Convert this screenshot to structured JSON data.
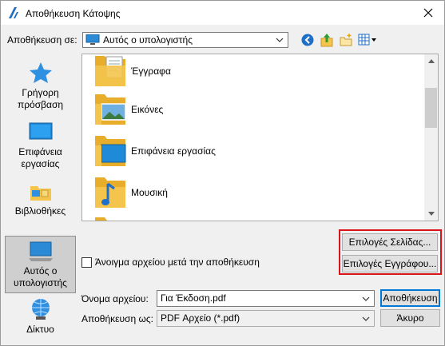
{
  "window": {
    "title": "Αποθήκευση Κάτοψης"
  },
  "toolbar": {
    "save_in_label": "Αποθήκευση σε:",
    "location_value": "Αυτός ο υπολογιστής",
    "icons": [
      "back-icon",
      "up-folder-icon",
      "new-folder-icon",
      "view-menu-icon"
    ]
  },
  "places": [
    {
      "label": "Γρήγορη πρόσβαση",
      "icon": "star-icon"
    },
    {
      "label": "Επιφάνεια εργασίας",
      "icon": "desktop-icon"
    },
    {
      "label": "Βιβλιοθήκες",
      "icon": "libraries-icon"
    },
    {
      "label": "Αυτός ο υπολογιστής",
      "icon": "computer-icon",
      "selected": true
    },
    {
      "label": "Δίκτυο",
      "icon": "network-icon"
    }
  ],
  "files": [
    {
      "name": "Έγγραφα",
      "icon": "documents-folder-icon"
    },
    {
      "name": "Εικόνες",
      "icon": "pictures-folder-icon"
    },
    {
      "name": "Επιφάνεια εργασίας",
      "icon": "desktop-folder-icon"
    },
    {
      "name": "Μουσική",
      "icon": "music-folder-icon"
    }
  ],
  "options": {
    "open_after_save_label": "Άνοιγμα αρχείου μετά την αποθήκευση",
    "open_after_save_checked": false,
    "page_options_button": "Επιλογές Σελίδας...",
    "document_options_button": "Επιλογές Εγγράφου..."
  },
  "form": {
    "filename_label": "Όνομα αρχείου:",
    "filename_value": "Για Έκδοση.pdf",
    "filetype_label": "Αποθήκευση ως:",
    "filetype_value": "PDF Αρχείο (*.pdf)",
    "save_button": "Αποθήκευση",
    "cancel_button": "Άκυρο"
  },
  "colors": {
    "highlight": "#d9141b",
    "accent": "#0078d7",
    "folder": "#f4c44d"
  }
}
